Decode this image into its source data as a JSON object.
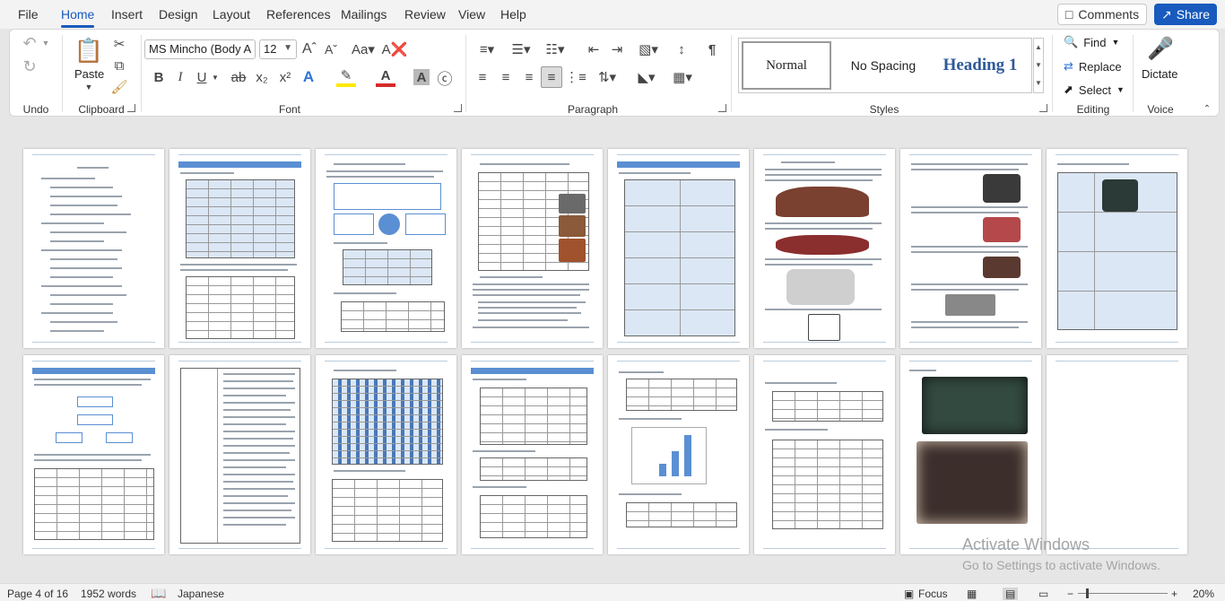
{
  "menu": {
    "tabs": [
      "File",
      "Home",
      "Insert",
      "Design",
      "Layout",
      "References",
      "Mailings",
      "Review",
      "View",
      "Help"
    ],
    "active_tab": "Home",
    "comments_label": "Comments",
    "share_label": "Share"
  },
  "ribbon": {
    "groups": {
      "undo": "Undo",
      "clipboard": "Clipboard",
      "font": "Font",
      "paragraph": "Paragraph",
      "styles": "Styles",
      "editing": "Editing",
      "voice": "Voice"
    },
    "paste_label": "Paste",
    "font_name": "MS Mincho (Body A",
    "font_size": "12",
    "styles": [
      "Normal",
      "No Spacing",
      "Heading 1"
    ],
    "editing": {
      "find": "Find",
      "replace": "Replace",
      "select": "Select"
    },
    "dictate": "Dictate"
  },
  "watermark": {
    "line1": "Activate Windows",
    "line2": "Go to Settings to activate Windows."
  },
  "status": {
    "page": "Page 4 of 16",
    "words": "1952 words",
    "language": "Japanese",
    "focus": "Focus",
    "zoom": "20%"
  },
  "accent_color": "#185abd"
}
